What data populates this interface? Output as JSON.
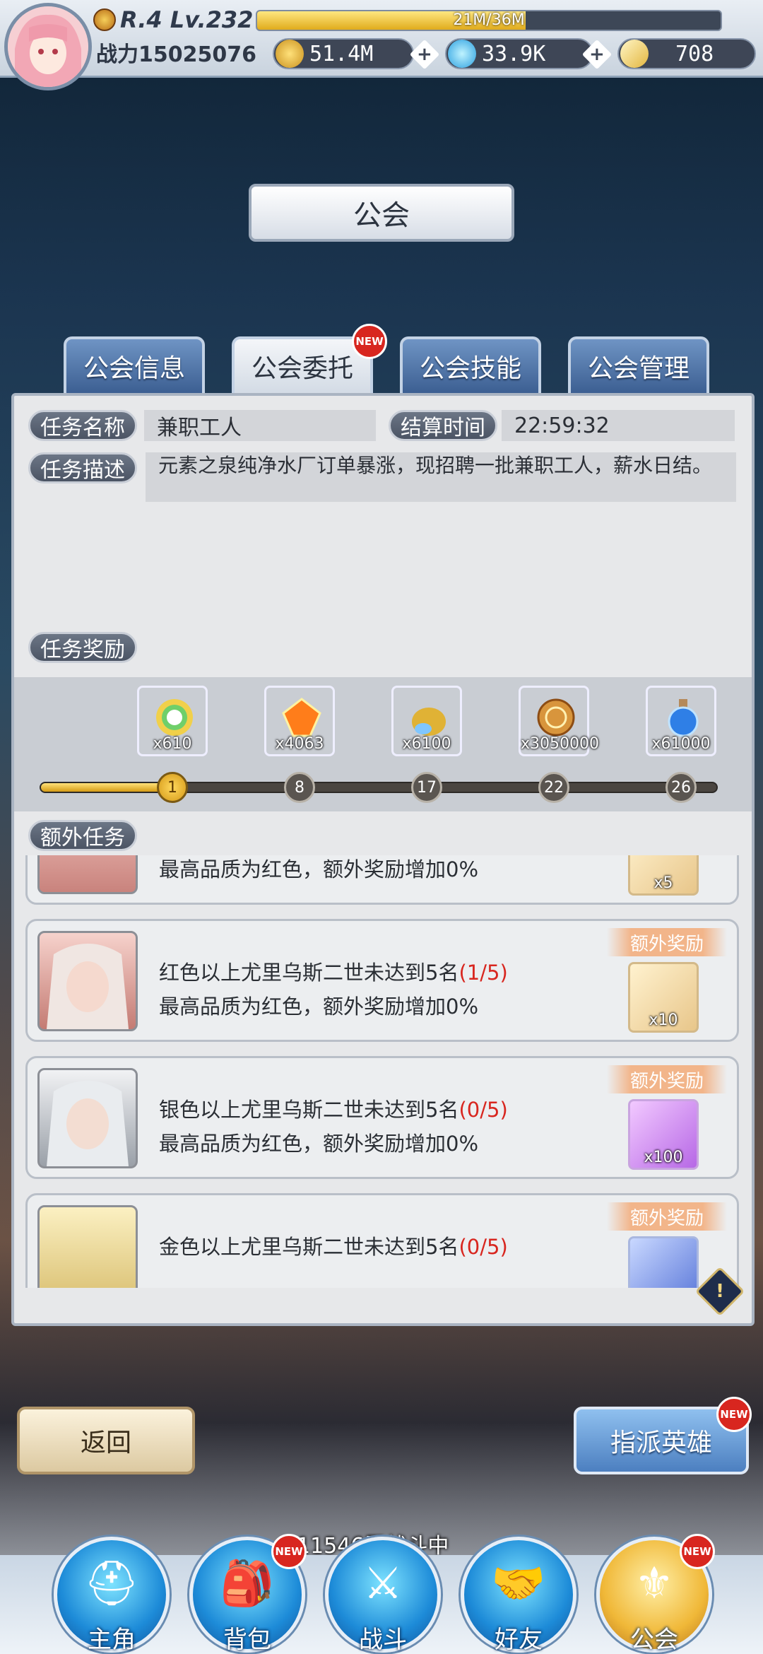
{
  "header": {
    "rank_level": "R.4 Lv.232",
    "exp_text": "21M/36M",
    "exp_fraction": 0.58,
    "power_label": "战力",
    "power_value": "15025076",
    "gold": "51.4M",
    "diamonds": "33.9K",
    "crystals": "708"
  },
  "title": "公会",
  "tabs": [
    {
      "label": "公会信息"
    },
    {
      "label": "公会委托",
      "badge": "NEW"
    },
    {
      "label": "公会技能"
    },
    {
      "label": "公会管理"
    }
  ],
  "task": {
    "name_label": "任务名称",
    "name_value": "兼职工人",
    "settle_label": "结算时间",
    "settle_value": "22:59:32",
    "desc_label": "任务描述",
    "desc_value": "元素之泉纯净水厂订单暴涨，现招聘一批兼职工人，薪水日结。"
  },
  "rewards": {
    "label": "任务奖励",
    "items": [
      {
        "icon": "rainbow-orb-icon",
        "qty": "x610",
        "color": "#8e5cc9"
      },
      {
        "icon": "orange-gem-icon",
        "qty": "x4063",
        "color": "#e8962a"
      },
      {
        "icon": "treasure-bag-icon",
        "qty": "x6100",
        "color": "#8e5cc9"
      },
      {
        "icon": "gold-coin-icon",
        "qty": "x3050000",
        "color": "#3f8ad6"
      },
      {
        "icon": "blue-potion-icon",
        "qty": "x61000",
        "color": "#3f8ad6"
      }
    ],
    "milestones": [
      "1",
      "8",
      "17",
      "22",
      "26"
    ],
    "progress_fraction": 0.19
  },
  "extra": {
    "label": "额外任务",
    "tag": "额外奖励",
    "tasks": [
      {
        "line1": "",
        "progress": "",
        "line2": "最高品质为红色，额外奖励增加0%",
        "reward_qty": "x5",
        "portrait": "red"
      },
      {
        "line1": "红色以上尤里乌斯二世未达到5名",
        "progress": "(1/5)",
        "line2": "最高品质为红色，额外奖励增加0%",
        "reward_qty": "x10",
        "portrait": "red"
      },
      {
        "line1": "银色以上尤里乌斯二世未达到5名",
        "progress": "(0/5)",
        "line2": "最高品质为红色，额外奖励增加0%",
        "reward_qty": "x100",
        "portrait": "silver"
      },
      {
        "line1": "金色以上尤里乌斯二世未达到5名",
        "progress": "(0/5)",
        "line2": "",
        "reward_qty": "",
        "portrait": "gold"
      }
    ]
  },
  "buttons": {
    "back": "返回",
    "assign": "指派英雄",
    "assign_badge": "NEW"
  },
  "battle_status": "11546层战斗中",
  "nav": [
    {
      "label": "主角",
      "icon": "helmet-icon"
    },
    {
      "label": "背包",
      "icon": "backpack-icon",
      "badge": "NEW"
    },
    {
      "label": "战斗",
      "icon": "crossed-swords-icon"
    },
    {
      "label": "好友",
      "icon": "handshake-icon"
    },
    {
      "label": "公会",
      "icon": "guild-emblem-icon",
      "badge": "NEW"
    }
  ]
}
